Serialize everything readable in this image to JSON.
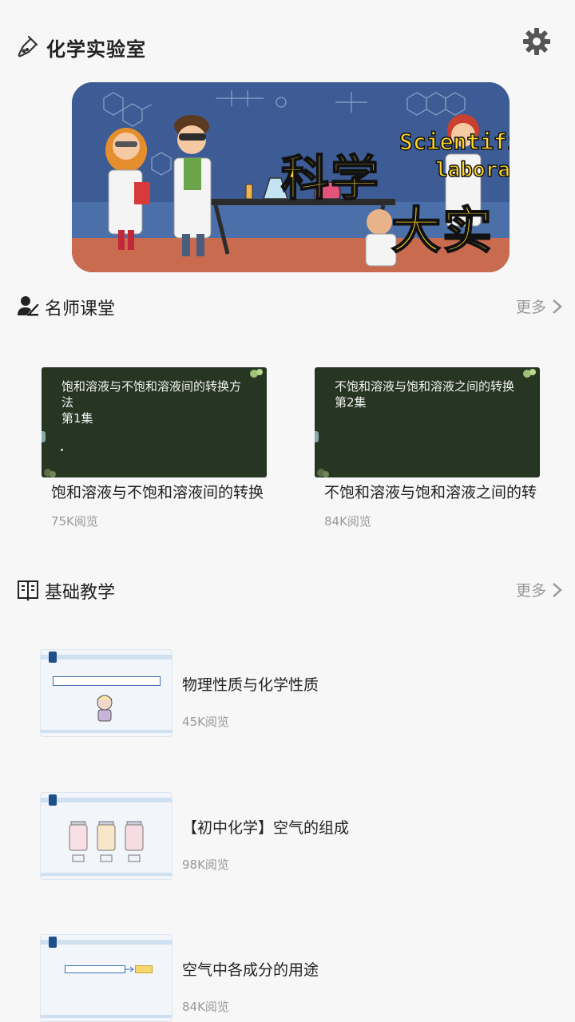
{
  "header": {
    "title": "化学实验室",
    "app_icon": "flask-icon",
    "settings_icon": "gear-icon"
  },
  "banner": {
    "line1": "Scientific",
    "line2": "laboratory",
    "big1": "科学",
    "big2": "大实验"
  },
  "teacher_section": {
    "title": "名师课堂",
    "more": "更多",
    "icon": "teacher-icon",
    "cards": [
      {
        "board_text": "饱和溶液与不饱和溶液间的转换方法",
        "episode": "第1集",
        "title": "饱和溶液与不饱和溶液间的转换",
        "views": "75K阅览"
      },
      {
        "board_text": "不饱和溶液与饱和溶液之间的转换",
        "episode": "第2集",
        "title": "不饱和溶液与饱和溶液之间的转",
        "views": "84K阅览"
      }
    ]
  },
  "basic_section": {
    "title": "基础教学",
    "more": "更多",
    "icon": "book-icon",
    "lessons": [
      {
        "title": "物理性质与化学性质",
        "views": "45K阅览"
      },
      {
        "title": "【初中化学】空气的组成",
        "views": "98K阅览"
      },
      {
        "title": "空气中各成分的用途",
        "views": "84K阅览"
      }
    ]
  },
  "colors": {
    "background": "#f7f7f7",
    "banner_bg": "#3a5a94",
    "banner_text": "#ffd624",
    "board": "#263623",
    "muted": "#999999"
  }
}
